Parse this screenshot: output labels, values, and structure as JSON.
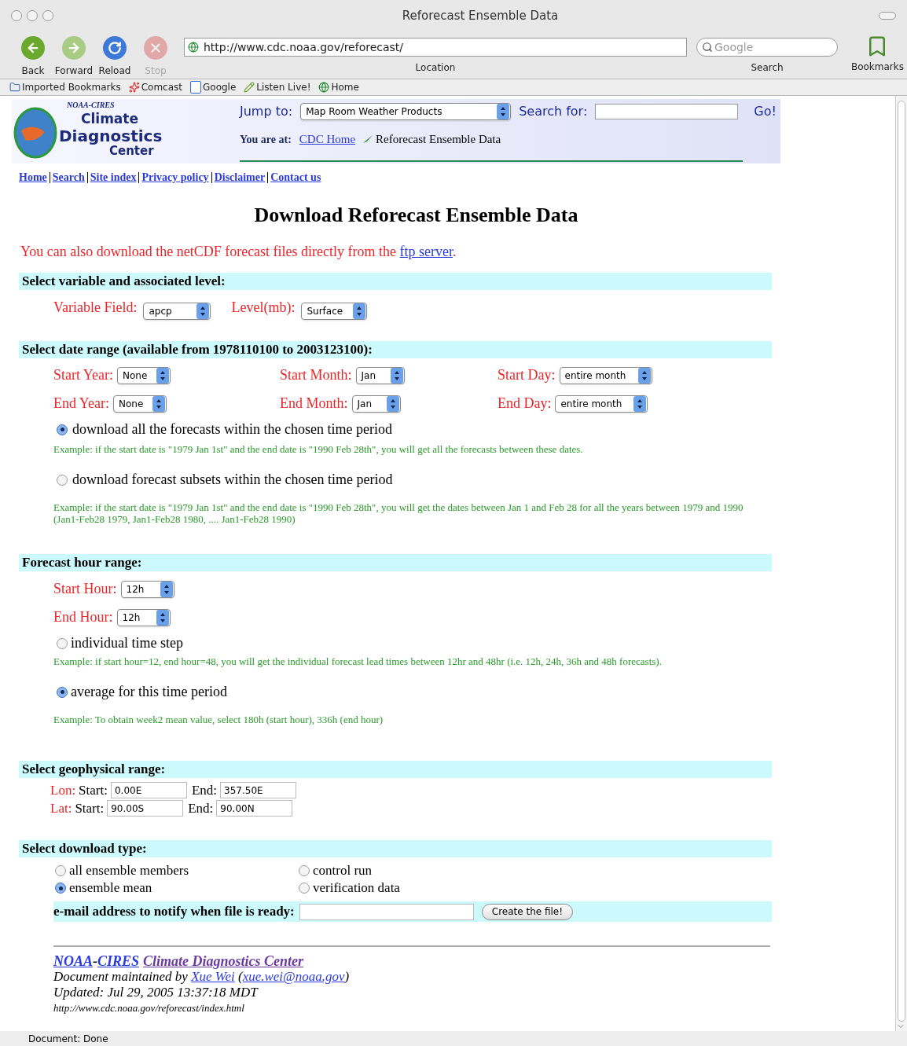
{
  "window": {
    "title": "Reforecast Ensemble Data"
  },
  "toolbar": {
    "buttons": [
      {
        "label": "Back",
        "kind": "back",
        "disabled": false
      },
      {
        "label": "Forward",
        "kind": "forward",
        "disabled": false
      },
      {
        "label": "Reload",
        "kind": "reload",
        "disabled": false
      },
      {
        "label": "Stop",
        "kind": "stop",
        "disabled": true
      }
    ],
    "location": {
      "value": "http://www.cdc.noaa.gov/reforecast/",
      "label": "Location"
    },
    "search": {
      "placeholder": "Google",
      "label": "Search"
    },
    "bookmarks": {
      "label": "Bookmarks"
    }
  },
  "bookmarks_bar": [
    {
      "label": "Imported Bookmarks",
      "kind": "folder"
    },
    {
      "label": "Comcast",
      "kind": "sparkle"
    },
    {
      "label": "Google",
      "kind": "letter"
    },
    {
      "label": "Listen Live!",
      "kind": "pen"
    },
    {
      "label": "Home",
      "kind": "globe"
    }
  ],
  "header": {
    "logo": {
      "top": "NOAA-CIRES",
      "lines": [
        "Climate",
        "Diagnostics",
        "Center"
      ]
    },
    "jump": {
      "label": "Jump to:",
      "value": "Map Room Weather Products"
    },
    "search": {
      "label": "Search for:",
      "button": "Go!"
    },
    "location": {
      "label": "You are at:",
      "link": "CDC Home",
      "current": "Reforecast Ensemble Data"
    }
  },
  "nav_links": [
    "Home",
    "Search",
    "Site index",
    "Privacy policy",
    "Disclaimer",
    "Contact us"
  ],
  "title": "Download Reforecast Ensemble Data",
  "intro": {
    "text": "You can also download the netCDF forecast files directly from the",
    "link": "ftp server",
    "end": "."
  },
  "variable_section": {
    "heading": "Select variable and associated level:",
    "fields": [
      {
        "label": "Variable Field:",
        "value": "apcp"
      },
      {
        "label": "Level(mb):",
        "value": "Surface"
      }
    ]
  },
  "date_section": {
    "heading": "Select date range (available from 1978110100 to 2003123100):",
    "rows": [
      [
        {
          "label": "Start Year:",
          "value": "None"
        },
        {
          "label": "Start Month:",
          "value": "Jan"
        },
        {
          "label": "Start Day:",
          "value": "entire month"
        }
      ],
      [
        {
          "label": "End Year:",
          "value": "None"
        },
        {
          "label": "End Month:",
          "value": "Jan"
        },
        {
          "label": "End Day:",
          "value": "entire month"
        }
      ]
    ],
    "options": [
      {
        "label": "download all the forecasts within the chosen time period",
        "selected": true,
        "example": "Example: if the start date is \"1979 Jan 1st\" and the end date is \"1990 Feb 28th\", you will get all the forecasts between these dates."
      },
      {
        "label": "download forecast subsets within the chosen time period",
        "selected": false,
        "example": "Example: if the start date is \"1979 Jan 1st\" and the end date is \"1990 Feb 28th\", you will get the dates between Jan 1 and Feb 28 for all the years between 1979 and 1990 (Jan1-Feb28 1979, Jan1-Feb28 1980, .... Jan1-Feb28 1990)"
      }
    ]
  },
  "hour_section": {
    "heading": "Forecast hour range:",
    "fields": [
      {
        "label": "Start Hour:",
        "value": "12h"
      },
      {
        "label": "End Hour:",
        "value": "12h"
      }
    ],
    "options": [
      {
        "label": "individual time step",
        "selected": false,
        "example": "Example: if start hour=12, end hour=48, you will get the individual forecast lead times between 12hr and 48hr (i.e. 12h, 24h, 36h and 48h forecasts)."
      },
      {
        "label": "average for this time period",
        "selected": true,
        "example": "Example: To obtain week2 mean value, select 180h (start hour), 336h (end hour)"
      }
    ]
  },
  "geo_section": {
    "heading": "Select geophysical range:",
    "rows": [
      {
        "label": "Lon:",
        "start_label": "Start:",
        "start": "0.00E",
        "end_label": "End:",
        "end": "357.50E"
      },
      {
        "label": "Lat:",
        "start_label": "Start:",
        "start": "90.00S",
        "end_label": "End:",
        "end": "90.00N"
      }
    ]
  },
  "type_section": {
    "heading": "Select download type:",
    "options": [
      {
        "label": "all ensemble members",
        "selected": false
      },
      {
        "label": "control run",
        "selected": false
      },
      {
        "label": "ensemble mean",
        "selected": true
      },
      {
        "label": "verification data",
        "selected": false
      }
    ],
    "email": {
      "label": "e-mail address to notify when file is ready:",
      "button": "Create the file!"
    }
  },
  "footer": {
    "org": [
      {
        "text": "NOAA",
        "kind": "link"
      },
      {
        "text": "-",
        "kind": "plain"
      },
      {
        "text": "CIRES",
        "kind": "link"
      },
      {
        "text": "Climate Diagnostics Center",
        "kind": "visited"
      }
    ],
    "maintained": {
      "text": "Document maintained by",
      "name": "Xue Wei",
      "open": "(",
      "email": "xue.wei@noaa.gov",
      "close": ")"
    },
    "updated": "Updated: Jul 29, 2005 13:37:18 MDT",
    "url": "http://www.cdc.noaa.gov/reforecast/index.html"
  },
  "status_bar": {
    "text": "Document: Done"
  }
}
